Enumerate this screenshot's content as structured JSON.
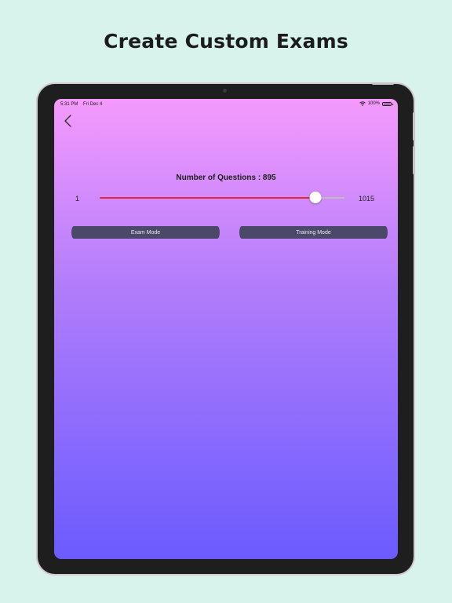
{
  "headline": "Create Custom Exams",
  "status_bar": {
    "time": "5:31 PM",
    "date": "Fri Dec 4",
    "battery": "100%",
    "battery_level": 1.0,
    "icons": [
      "wifi-icon",
      "battery-icon"
    ]
  },
  "nav": {
    "back_icon": "chevron-left-icon"
  },
  "questions": {
    "label": "Number of Questions : 895",
    "value": 895,
    "min": 1,
    "max": 1015,
    "min_label": "1",
    "max_label": "1015"
  },
  "buttons": {
    "exam_mode": "Exam Mode",
    "training_mode": "Training Mode"
  },
  "colors": {
    "page_background": "#d8f3ec",
    "gradient_top": "#f59afc",
    "gradient_bottom": "#6b5bff",
    "slider_fill": "#e8243a",
    "button_background": "#4b4869"
  }
}
